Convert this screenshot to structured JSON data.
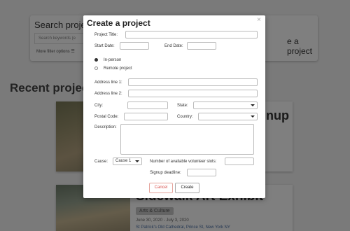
{
  "background": {
    "search_title": "Search projects",
    "search_placeholder": "Search keywords (e",
    "filter_label": "More filter options",
    "create_label": "e a project",
    "recent_title": "Recent projects",
    "card1_title": "nup",
    "card2_title": "Sidewalk Art Exhibit",
    "card2_tag": "Arts & Culture",
    "card2_date": "June 30, 2020 - July 3, 2020",
    "card2_location": "St Patrick's Old Cathedral, Prince St, New York NY"
  },
  "modal": {
    "title": "Create a project",
    "close_glyph": "×",
    "project_title_label": "Project Title:",
    "start_date_label": "Start Date:",
    "end_date_label": "End Date:",
    "in_person_label": "In-person",
    "remote_label": "Remote project",
    "address1_label": "Address line 1:",
    "address2_label": "Address line 2:",
    "city_label": "City:",
    "state_label": "State:",
    "postal_label": "Postal Code:",
    "country_label": "Country:",
    "description_label": "Description:",
    "cause_label": "Cause:",
    "cause_value": "Cause 1",
    "slots_label": "Number of available volunteer slots:",
    "deadline_label": "Signup deadline:",
    "cancel_label": "Cancel",
    "create_label": "Create",
    "selected_type": "in-person"
  }
}
